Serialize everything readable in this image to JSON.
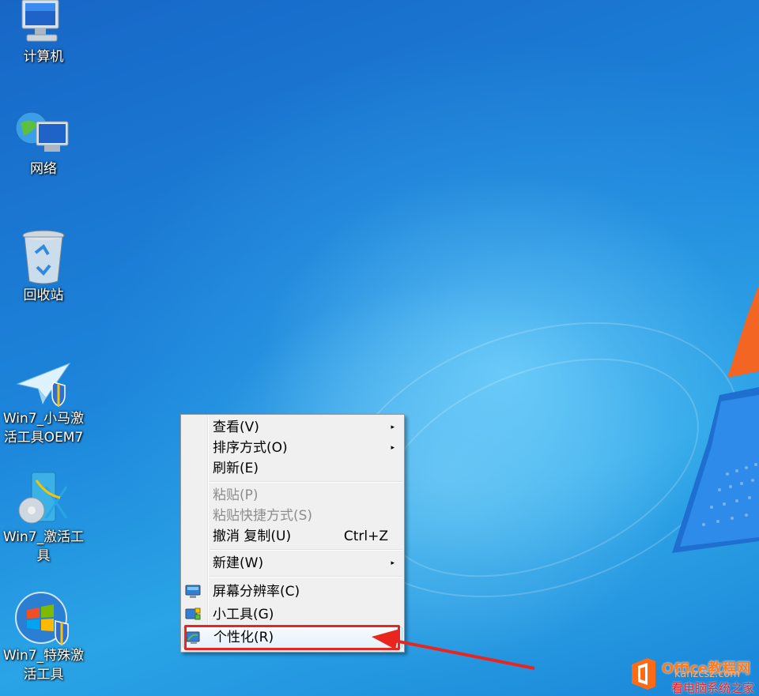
{
  "desktop": {
    "icons": [
      {
        "label": "计算机",
        "icon": "computer-icon"
      },
      {
        "label": "网络",
        "icon": "network-icon"
      },
      {
        "label": "回收站",
        "icon": "recycle-bin-icon"
      },
      {
        "label_line1": "Win7_小马激",
        "label_line2": "活工具OEM7",
        "icon": "paper-plane-shield-icon"
      },
      {
        "label_line1": "Win7_激活工",
        "label_line2": "具",
        "icon": "activation-tool-icon"
      },
      {
        "label_line1": "Win7_特殊激",
        "label_line2": "活工具",
        "icon": "windows-shield-icon"
      }
    ]
  },
  "context_menu": {
    "items": {
      "view": {
        "label": "查看(V)",
        "submenu": true
      },
      "sort_by": {
        "label": "排序方式(O)",
        "submenu": true
      },
      "refresh": {
        "label": "刷新(E)"
      },
      "paste": {
        "label": "粘贴(P)",
        "disabled": true
      },
      "paste_shortcut": {
        "label": "粘贴快捷方式(S)",
        "disabled": true
      },
      "undo_copy": {
        "label": "撤消 复制(U)",
        "shortcut": "Ctrl+Z"
      },
      "new": {
        "label": "新建(W)",
        "submenu": true
      },
      "screen_resolution": {
        "label": "屏幕分辨率(C)",
        "icon": "display-icon"
      },
      "gadgets": {
        "label": "小工具(G)",
        "icon": "gadgets-icon"
      },
      "personalize": {
        "label": "个性化(R)",
        "icon": "personalize-icon"
      }
    },
    "submenu_glyph": "▸"
  },
  "annotation": {
    "highlight_color": "#e8261f"
  },
  "watermark": {
    "title": "Office教程网",
    "url": "kanzcsz.com",
    "subtitle": "看电脑系统之家"
  },
  "colors": {
    "desktop_blue": "#1a7ed6",
    "menu_bg": "#f0f0f0",
    "accent_orange": "#ff7a1a"
  }
}
